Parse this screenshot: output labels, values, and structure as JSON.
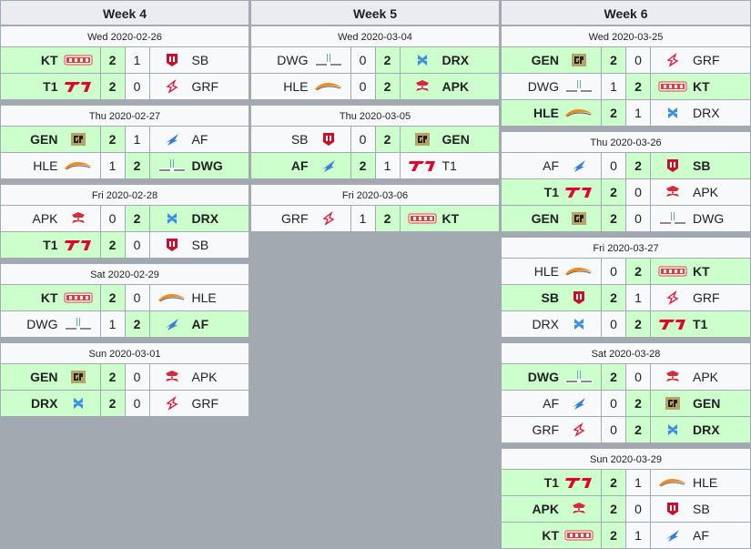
{
  "weeks": [
    {
      "title": "Week 4",
      "days": [
        {
          "date": "Wed 2020-02-26",
          "matches": [
            {
              "team1": "KT",
              "logo1": "kt-logo",
              "score1": "2",
              "score2": "1",
              "team2": "SB",
              "logo2": "sb-logo",
              "winner": 1
            },
            {
              "team1": "T1",
              "logo1": "t1-logo",
              "score1": "2",
              "score2": "0",
              "team2": "GRF",
              "logo2": "grf-logo",
              "winner": 1
            }
          ]
        },
        {
          "date": "Thu 2020-02-27",
          "matches": [
            {
              "team1": "GEN",
              "logo1": "gen-logo",
              "score1": "2",
              "score2": "1",
              "team2": "AF",
              "logo2": "af-logo",
              "winner": 1
            },
            {
              "team1": "HLE",
              "logo1": "hle-logo",
              "score1": "1",
              "score2": "2",
              "team2": "DWG",
              "logo2": "dwg-logo",
              "winner": 2
            }
          ]
        },
        {
          "date": "Fri 2020-02-28",
          "matches": [
            {
              "team1": "APK",
              "logo1": "apk-logo",
              "score1": "0",
              "score2": "2",
              "team2": "DRX",
              "logo2": "drx-logo",
              "winner": 2
            },
            {
              "team1": "T1",
              "logo1": "t1-logo",
              "score1": "2",
              "score2": "0",
              "team2": "SB",
              "logo2": "sb-logo",
              "winner": 1
            }
          ]
        },
        {
          "date": "Sat 2020-02-29",
          "matches": [
            {
              "team1": "KT",
              "logo1": "kt-logo",
              "score1": "2",
              "score2": "0",
              "team2": "HLE",
              "logo2": "hle-logo",
              "winner": 1
            },
            {
              "team1": "DWG",
              "logo1": "dwg-logo",
              "score1": "1",
              "score2": "2",
              "team2": "AF",
              "logo2": "af-logo",
              "winner": 2
            }
          ]
        },
        {
          "date": "Sun 2020-03-01",
          "matches": [
            {
              "team1": "GEN",
              "logo1": "gen-logo",
              "score1": "2",
              "score2": "0",
              "team2": "APK",
              "logo2": "apk-logo",
              "winner": 1
            },
            {
              "team1": "DRX",
              "logo1": "drx-logo",
              "score1": "2",
              "score2": "0",
              "team2": "GRF",
              "logo2": "grf-logo",
              "winner": 1
            }
          ]
        }
      ]
    },
    {
      "title": "Week 5",
      "days": [
        {
          "date": "Wed 2020-03-04",
          "matches": [
            {
              "team1": "DWG",
              "logo1": "dwg-logo",
              "score1": "0",
              "score2": "2",
              "team2": "DRX",
              "logo2": "drx-logo",
              "winner": 2
            },
            {
              "team1": "HLE",
              "logo1": "hle-logo",
              "score1": "0",
              "score2": "2",
              "team2": "APK",
              "logo2": "apk-logo",
              "winner": 2
            }
          ]
        },
        {
          "date": "Thu 2020-03-05",
          "matches": [
            {
              "team1": "SB",
              "logo1": "sb-logo",
              "score1": "0",
              "score2": "2",
              "team2": "GEN",
              "logo2": "gen-logo",
              "winner": 2
            },
            {
              "team1": "AF",
              "logo1": "af-logo",
              "score1": "2",
              "score2": "1",
              "team2": "T1",
              "logo2": "t1-logo",
              "winner": 1
            }
          ]
        },
        {
          "date": "Fri 2020-03-06",
          "matches": [
            {
              "team1": "GRF",
              "logo1": "grf-logo",
              "score1": "1",
              "score2": "2",
              "team2": "KT",
              "logo2": "kt-logo",
              "winner": 2
            }
          ]
        }
      ]
    },
    {
      "title": "Week 6",
      "days": [
        {
          "date": "Wed 2020-03-25",
          "matches": [
            {
              "team1": "GEN",
              "logo1": "gen-logo",
              "score1": "2",
              "score2": "0",
              "team2": "GRF",
              "logo2": "grf-logo",
              "winner": 1
            },
            {
              "team1": "DWG",
              "logo1": "dwg-logo",
              "score1": "1",
              "score2": "2",
              "team2": "KT",
              "logo2": "kt-logo",
              "winner": 2
            },
            {
              "team1": "HLE",
              "logo1": "hle-logo",
              "score1": "2",
              "score2": "1",
              "team2": "DRX",
              "logo2": "drx-logo",
              "winner": 1
            }
          ]
        },
        {
          "date": "Thu 2020-03-26",
          "matches": [
            {
              "team1": "AF",
              "logo1": "af-logo",
              "score1": "0",
              "score2": "2",
              "team2": "SB",
              "logo2": "sb-logo",
              "winner": 2
            },
            {
              "team1": "T1",
              "logo1": "t1-logo",
              "score1": "2",
              "score2": "0",
              "team2": "APK",
              "logo2": "apk-logo",
              "winner": 1
            },
            {
              "team1": "GEN",
              "logo1": "gen-logo",
              "score1": "2",
              "score2": "0",
              "team2": "DWG",
              "logo2": "dwg-logo",
              "winner": 1
            }
          ]
        },
        {
          "date": "Fri 2020-03-27",
          "matches": [
            {
              "team1": "HLE",
              "logo1": "hle-logo",
              "score1": "0",
              "score2": "2",
              "team2": "KT",
              "logo2": "kt-logo",
              "winner": 2
            },
            {
              "team1": "SB",
              "logo1": "sb-logo",
              "score1": "2",
              "score2": "1",
              "team2": "GRF",
              "logo2": "grf-logo",
              "winner": 1
            },
            {
              "team1": "DRX",
              "logo1": "drx-logo",
              "score1": "0",
              "score2": "2",
              "team2": "T1",
              "logo2": "t1-logo",
              "winner": 2
            }
          ]
        },
        {
          "date": "Sat 2020-03-28",
          "matches": [
            {
              "team1": "DWG",
              "logo1": "dwg-logo",
              "score1": "2",
              "score2": "0",
              "team2": "APK",
              "logo2": "apk-logo",
              "winner": 1
            },
            {
              "team1": "AF",
              "logo1": "af-logo",
              "score1": "0",
              "score2": "2",
              "team2": "GEN",
              "logo2": "gen-logo",
              "winner": 2
            },
            {
              "team1": "GRF",
              "logo1": "grf-logo",
              "score1": "0",
              "score2": "2",
              "team2": "DRX",
              "logo2": "drx-logo",
              "winner": 2
            }
          ]
        },
        {
          "date": "Sun 2020-03-29",
          "matches": [
            {
              "team1": "T1",
              "logo1": "t1-logo",
              "score1": "2",
              "score2": "1",
              "team2": "HLE",
              "logo2": "hle-logo",
              "winner": 1
            },
            {
              "team1": "APK",
              "logo1": "apk-logo",
              "score1": "2",
              "score2": "0",
              "team2": "SB",
              "logo2": "sb-logo",
              "winner": 1
            },
            {
              "team1": "KT",
              "logo1": "kt-logo",
              "score1": "2",
              "score2": "1",
              "team2": "AF",
              "logo2": "af-logo",
              "winner": 1
            }
          ]
        }
      ]
    }
  ],
  "colors": {
    "win": "#ccffcc",
    "cell": "#f8f9fa",
    "header": "#eaecf0",
    "border": "#a2a9b1",
    "background": "#a3a9b1"
  }
}
